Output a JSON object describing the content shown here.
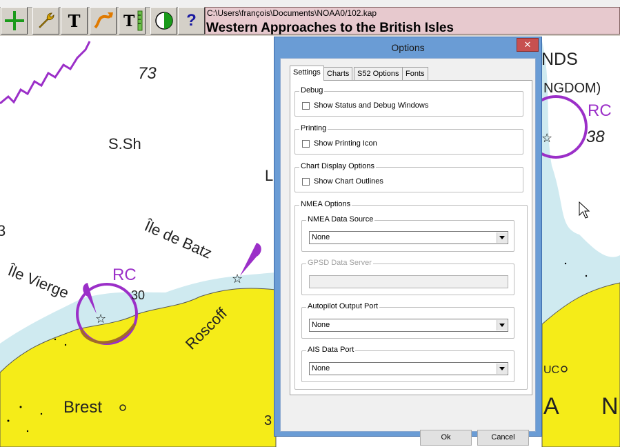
{
  "toolbar": {
    "buttons": [
      {
        "name": "add-icon"
      },
      {
        "name": "wrench-icon"
      },
      {
        "name": "text-icon"
      },
      {
        "name": "route-icon"
      },
      {
        "name": "text-ruler-icon"
      },
      {
        "name": "day-night-icon"
      },
      {
        "name": "help-icon",
        "glyph": "?"
      }
    ],
    "text_glyph": "T",
    "file_path": "C:\\Users\\françois\\Documents\\NOAA0/102.kap",
    "chart_title": "Western Approaches to the British Isles"
  },
  "map": {
    "labels": {
      "depth_73": "73",
      "ssh": "S.Sh",
      "ile_de_batz": "Île de Batz",
      "ile_vierge": "Île Vierge",
      "rc_left": "RC",
      "rc_right": "RC",
      "n30": "30",
      "n38": "38",
      "roscoff": "Roscoff",
      "brest": "Brest",
      "n3": "3",
      "ands": "NDS",
      "ngdom": "NGDOM)",
      "l_char": "L",
      "a_char": "A",
      "n_char": "N",
      "uc": "UC",
      "left_3": "3"
    },
    "colors": {
      "land": "#f5ec18",
      "shallow": "#cfeaf0",
      "purple": "#9b2fc8",
      "water": "#ffffff"
    }
  },
  "dialog": {
    "title": "Options",
    "close_glyph": "✕",
    "tabs": [
      {
        "label": "Settings",
        "active": true
      },
      {
        "label": "Charts",
        "active": false
      },
      {
        "label": "S52 Options",
        "active": false
      },
      {
        "label": "Fonts",
        "active": false
      }
    ],
    "debug": {
      "label": "Debug",
      "checkbox": "Show Status and Debug Windows",
      "checked": false
    },
    "printing": {
      "label": "Printing",
      "checkbox": "Show Printing Icon",
      "checked": false
    },
    "chart_display": {
      "label": "Chart Display Options",
      "checkbox": "Show Chart Outlines",
      "checked": false
    },
    "nmea": {
      "label": "NMEA Options",
      "data_source": {
        "label": "NMEA Data Source",
        "value": "None"
      },
      "gpsd": {
        "label": "GPSD Data Server",
        "value": ""
      },
      "autopilot": {
        "label": "Autopilot Output Port",
        "value": "None"
      },
      "ais": {
        "label": "AIS Data Port",
        "value": "None"
      }
    },
    "ok_label": "Ok",
    "cancel_label": "Cancel"
  }
}
